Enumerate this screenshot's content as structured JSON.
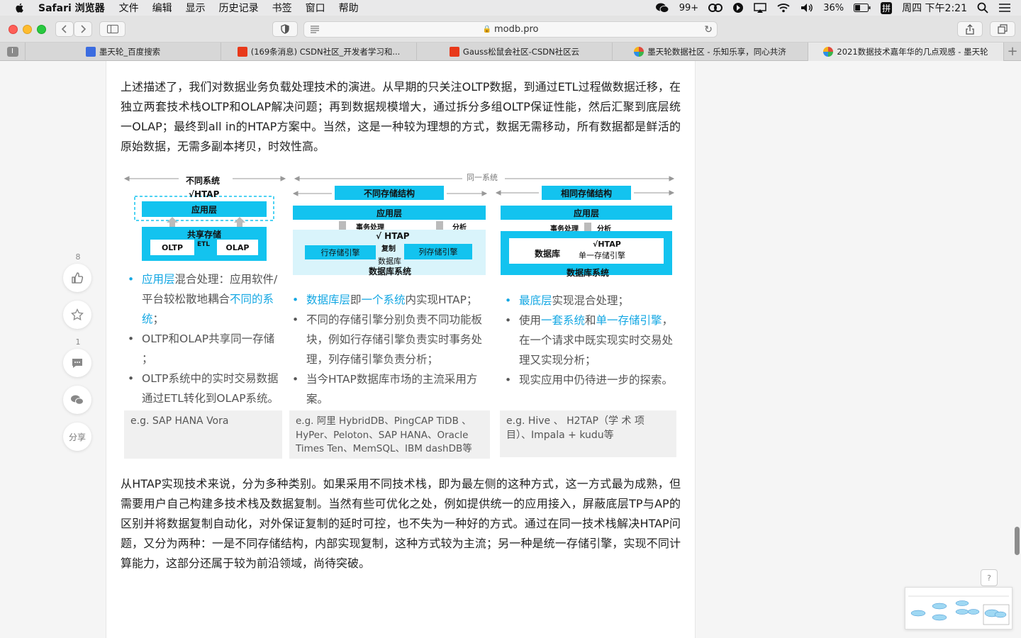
{
  "menubar": {
    "app_name": "Safari 浏览器",
    "items": [
      "文件",
      "编辑",
      "显示",
      "历史记录",
      "书签",
      "窗口",
      "帮助"
    ],
    "wechat_count": "99+",
    "battery": "36%",
    "input_method": "拼",
    "clock": "周四 下午2:21"
  },
  "toolbar": {
    "url": "modb.pro"
  },
  "tabs": [
    {
      "title": "墨天轮_百度搜索",
      "favicon_color": "#3b6ce0"
    },
    {
      "title": "(169条消息) CSDN社区_开发者学习和...",
      "favicon_color": "#e8391a"
    },
    {
      "title": "Gauss松鼠会社区-CSDN社区云",
      "favicon_color": "#e8391a"
    },
    {
      "title": "墨天轮数据社区 - 乐知乐享，同心共济",
      "favicon_color": "#e04a3f"
    },
    {
      "title": "2021数据技术嘉年华的几点观感 - 墨天轮",
      "favicon_color": "#e04a3f"
    }
  ],
  "article": {
    "para1": "上述描述了，我们对数据业务负载处理技术的演进。从早期的只关注OLTP数据，到通过ETL过程做数据迁移，在独立两套技术栈OLTP和OLAP解决问题；再到数据规模增大，通过拆分多组OLTP保证性能，然后汇聚到底层统一OLAP；最终到all in的HTAP方案中。当然，这是一种较为理想的方式，数据无需移动，所有数据都是鲜活的原始数据，无需多副本拷贝，时效性高。",
    "para2": "从HTAP实现技术来说，分为多种类别。如果采用不同技术栈，即为最左侧的这种方式，这一方式最为成熟，但需要用户自己构建多技术栈及数据复制。当然有些可优化之处，例如提供统一的应用接入，屏蔽底层TP与AP的区别并将数据复制自动化，对外保证复制的延时可控，也不失为一种好的方式。通过在同一技术栈解决HTAP问题，又分为两种：一是不同存储结构，内部实现复制，这种方式较为主流；另一种是统一存储引擎，实现不同计算能力，这部分还属于较为前沿领域，尚待突破。"
  },
  "actions": {
    "like_count": "8",
    "comment_count": "1",
    "share_label": "分享"
  },
  "figure": {
    "top_left": "不同系统",
    "top_right": "同一系统",
    "col1": {
      "htap": "√HTAP",
      "app_layer": "应用层",
      "shared_storage": "共享存储",
      "oltp": "OLTP",
      "etl": "ETL",
      "olap": "OLAP",
      "bullet1_hl": "应用层",
      "bullet1_a": "混合处理：应用软件/平台较松散地耦合",
      "bullet1_hl2": "不同的系统",
      "bullet1_b": "；",
      "bullet2": "OLTP和OLAP共享同一存储 ；",
      "bullet3": "OLTP系统中的实时交易数据通过ETL转化到OLAP系统。",
      "eg": "e.g. SAP HANA Vora"
    },
    "col2": {
      "header": "不同存储结构",
      "app_layer": "应用层",
      "tx": "事务处理",
      "analysis": "分析",
      "htap": "√ HTAP",
      "row_engine": "行存储引擎",
      "copy": "复制",
      "col_engine": "列存储引擎",
      "db": "数据库",
      "db_system": "数据库系统",
      "bullet1_hl": "数据库层",
      "bullet1_a": "即",
      "bullet1_hl2": "一个系统",
      "bullet1_b": "内实现HTAP；",
      "bullet2": "不同的存储引擎分别负责不同功能板块，例如行存储引擎负责实时事务处理，列存储引擎负责分析；",
      "bullet3": "当今HTAP数据库市场的主流采用方案。",
      "eg": "e.g. 阿里 HybridDB、PingCAP TiDB 、HyPer、Peloton、SAP HANA、Oracle Times Ten、MemSQL、IBM dashDB等"
    },
    "col3": {
      "header": "相同存储结构",
      "app_layer": "应用层",
      "tx": "事务处理",
      "analysis": "分析",
      "htap": "√HTAP",
      "db": "数据库",
      "single_engine": "单一存储引擎",
      "db_system": "数据库系统",
      "bullet1_hl": "最底层",
      "bullet1_a": "实现混合处理；",
      "bullet2_a": "使用",
      "bullet2_hl": "一套系统",
      "bullet2_b": "和",
      "bullet2_hl2": "单一存储引擎",
      "bullet2_c": "，在一个请求中既实现实时交易处理又实现分析；",
      "bullet3": "现实应用中仍待进一步的探索。",
      "eg": "e.g.   Hive 、 H2TAP（学 术 项 目）、Impala + kudu等"
    }
  }
}
